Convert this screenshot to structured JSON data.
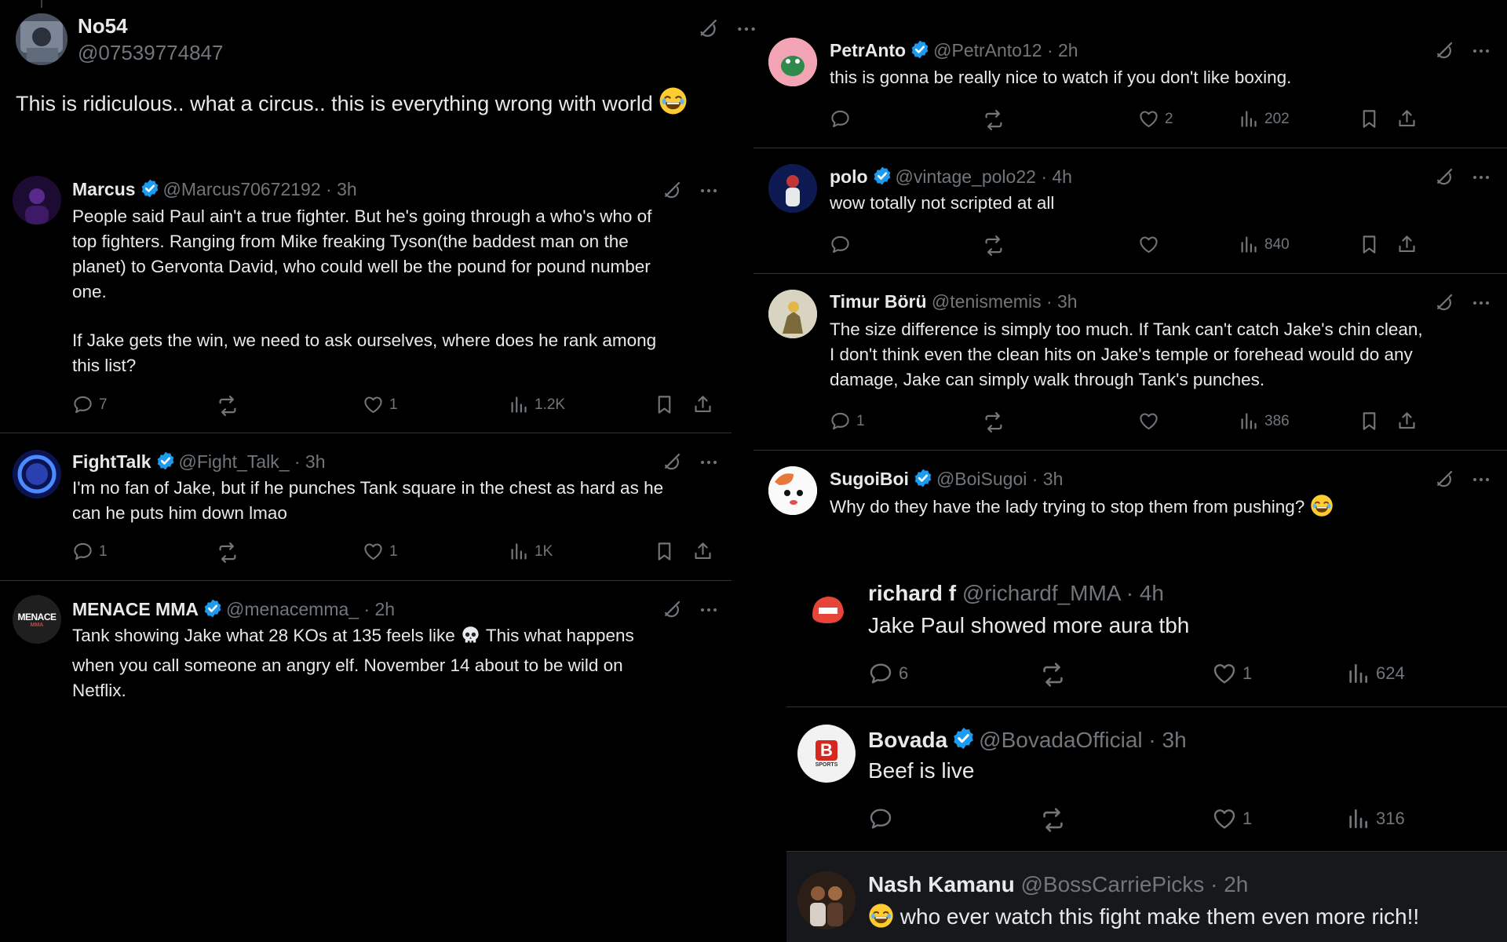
{
  "left": {
    "main_post": {
      "name": "No54",
      "handle": "@07539774847",
      "text": "This is ridiculous.. what a circus.. this is everything wrong with world",
      "emoji": "laughing-emoji"
    },
    "replies": [
      {
        "name": "Marcus",
        "handle": "@Marcus70672192",
        "time": "· 3h",
        "lines": [
          "People said Paul ain't a true fighter. But he's going through a who's who of",
          "top fighters. Ranging from Mike freaking Tyson(the baddest man on the",
          "planet) to Gervonta David, who could well be the pound for pound number",
          "one.",
          "If Jake gets the win, we need to ask ourselves, where does he rank among",
          "this list?"
        ],
        "replies": "7",
        "likes": "1",
        "views": "1.2K"
      },
      {
        "name": "FightTalk",
        "handle": "@Fight_Talk_",
        "time": "· 3h",
        "lines": [
          "I'm no fan of Jake, but if he punches Tank square in the chest as hard as he",
          "can he puts him down lmao"
        ],
        "replies": "1",
        "likes": "1",
        "views": "1K"
      },
      {
        "name": "MENACE MMA",
        "handle": "@menacemma_",
        "time": "· 2h",
        "lines": [
          "Tank showing Jake what 28 KOs at 135 feels like",
          "This what happens",
          "when you call someone an angry elf. November 14 about to be wild on",
          "Netflix."
        ],
        "avatar_text": "MENACE",
        "avatar_subtext": "MMA"
      }
    ]
  },
  "right": {
    "replies": [
      {
        "name": "PetrAnto",
        "handle": "@PetrAnto12",
        "time": "· 2h",
        "lines": [
          "this is gonna be really nice to watch if you don't like boxing."
        ],
        "replies": "",
        "likes": "2",
        "views": "202"
      },
      {
        "name": "polo",
        "handle": "@vintage_polo22",
        "time": "· 4h",
        "lines": [
          "wow totally not scripted at all"
        ],
        "replies": "",
        "likes": "",
        "views": "840"
      },
      {
        "name": "Timur Börü",
        "handle": "@tenismemis",
        "time": "· 3h",
        "lines": [
          "The size difference is simply too much. If Tank can't catch Jake's chin clean,",
          "I don't think even the clean hits on Jake's temple or forehead would do any",
          "damage, Jake can simply walk through Tank's punches."
        ],
        "replies": "1",
        "likes": "",
        "views": "386"
      },
      {
        "name": "SugoiBoi",
        "handle": "@BoiSugoi",
        "time": "· 3h",
        "lines": [
          "Why do they have the lady trying to stop them from pushing?"
        ]
      }
    ],
    "nested": [
      {
        "name": "richard f",
        "handle": "@richardf_MMA",
        "time": "· 4h",
        "text": "Jake Paul showed more aura tbh",
        "replies": "6",
        "likes": "1",
        "views": "624"
      },
      {
        "name": "Bovada",
        "handle": "@BovadaOfficial",
        "time": "· 3h",
        "text": "Beef is live",
        "replies": "",
        "likes": "1",
        "views": "316",
        "avatar_text": "B",
        "avatar_subtext": "SPORTS"
      },
      {
        "name": "Nash Kamanu",
        "handle": "@BossCarriePicks",
        "time": "· 2h",
        "text": "who ever watch this fight make them even more rich!!"
      }
    ]
  },
  "colors": {
    "background": "#000000",
    "text": "#e7e9ea",
    "secondary": "#71767b",
    "divider": "#2f3336",
    "verified": "#1d9bf0",
    "highlight": "#16181c"
  }
}
